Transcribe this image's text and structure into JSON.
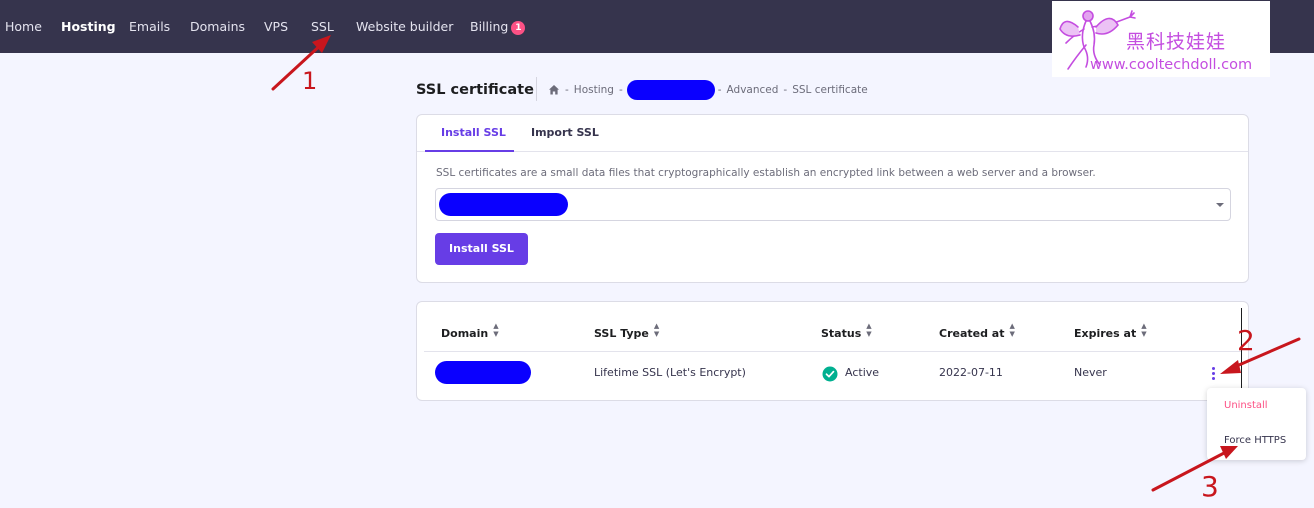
{
  "nav": {
    "items": [
      {
        "label": "Home",
        "active": false
      },
      {
        "label": "Hosting",
        "active": true
      },
      {
        "label": "Emails",
        "active": false
      },
      {
        "label": "Domains",
        "active": false
      },
      {
        "label": "VPS",
        "active": false
      },
      {
        "label": "SSL",
        "active": false
      },
      {
        "label": "Website builder",
        "active": false
      },
      {
        "label": "Billing",
        "active": false
      }
    ],
    "billing_badge": "1"
  },
  "watermark": {
    "text_cn": "黑科技娃娃",
    "url": "www.cooltechdoll.com",
    "icon": "fairy-logo"
  },
  "header": {
    "title": "SSL certificate",
    "breadcrumb": {
      "icon": "home-icon",
      "hosting": "Hosting",
      "advanced": "Advanced",
      "current": "SSL certificate",
      "separator": "-"
    }
  },
  "install_card": {
    "tabs": [
      {
        "label": "Install SSL",
        "active": true
      },
      {
        "label": "Import SSL",
        "active": false
      }
    ],
    "description": "SSL certificates are a small data files that cryptographically establish an encrypted link between a web server and a browser.",
    "install_button": "Install SSL"
  },
  "table": {
    "columns": [
      "Domain",
      "SSL Type",
      "Status",
      "Created at",
      "Expires at"
    ],
    "sort_icon": "sort-icon",
    "rows": [
      {
        "ssl_type": "Lifetime SSL (Let's Encrypt)",
        "status": "Active",
        "created_at": "2022-07-11",
        "expires_at": "Never"
      }
    ]
  },
  "row_menu": {
    "uninstall": "Uninstall",
    "force_https": "Force HTTPS"
  },
  "annotations": {
    "numbers": [
      "1",
      "2",
      "3"
    ],
    "color": "#c8161d"
  },
  "colors": {
    "accent": "#673de6",
    "nav_bg": "#36344d",
    "success": "#00b090",
    "danger": "#fc5185",
    "redaction": "#0a00ff"
  }
}
